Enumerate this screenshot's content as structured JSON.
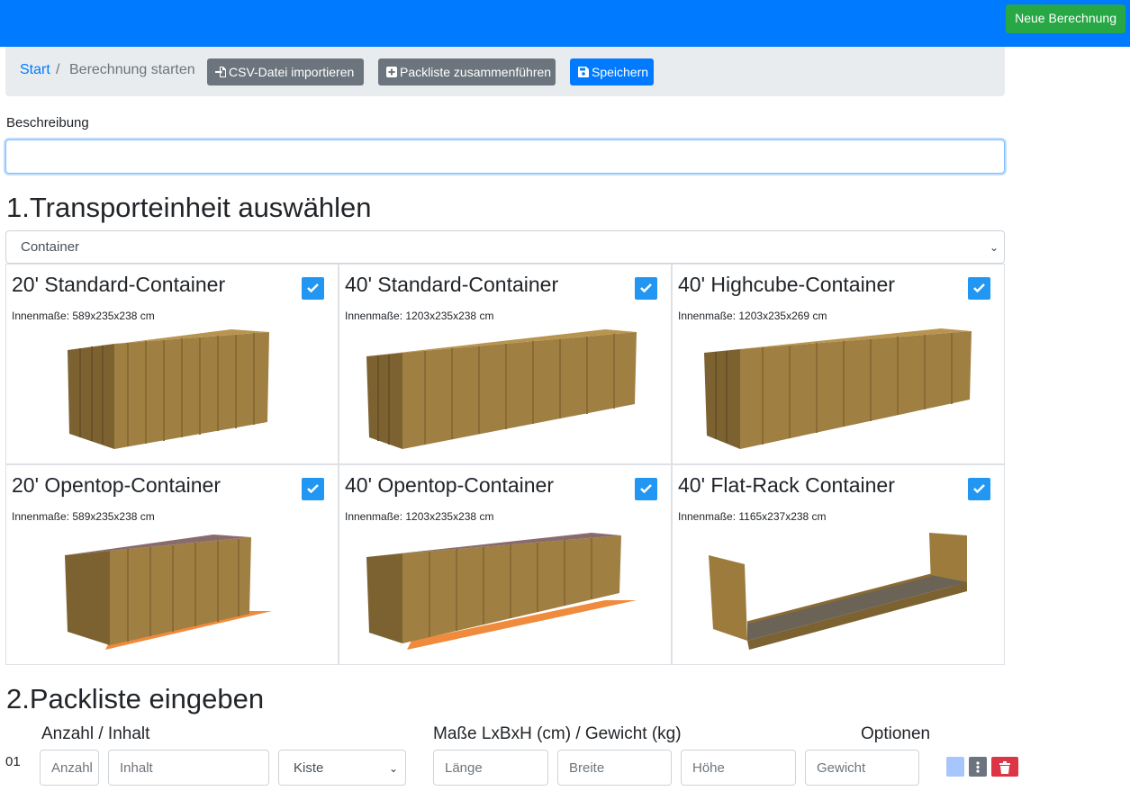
{
  "header": {
    "new_button": "Neue Berechnung"
  },
  "breadcrumb": {
    "start": "Start",
    "separator": "/",
    "current": "Berechnung starten"
  },
  "toolbar": {
    "csv_import": "CSV-Datei importieren",
    "merge_packlist": "Packliste zusammenführen",
    "save": "Speichern"
  },
  "description": {
    "label": "Beschreibung",
    "value": ""
  },
  "section1": {
    "title": "1.Transporteinheit auswählen",
    "select_value": "Container",
    "cards": [
      {
        "title": "20' Standard-Container",
        "dims": "Innenmaße: 589x235x238 cm",
        "checked": true,
        "icon": "standard-container-20"
      },
      {
        "title": "40' Standard-Container",
        "dims": "Innenmaße: 1203x235x238 cm",
        "checked": true,
        "icon": "standard-container-40"
      },
      {
        "title": "40' Highcube-Container",
        "dims": "Innenmaße: 1203x235x269 cm",
        "checked": true,
        "icon": "highcube-container-40"
      },
      {
        "title": "20' Opentop-Container",
        "dims": "Innenmaße: 589x235x238 cm",
        "checked": true,
        "icon": "opentop-container-20"
      },
      {
        "title": "40' Opentop-Container",
        "dims": "Innenmaße: 1203x235x238 cm",
        "checked": true,
        "icon": "opentop-container-40"
      },
      {
        "title": "40' Flat-Rack Container",
        "dims": "Innenmaße: 1165x237x238 cm",
        "checked": true,
        "icon": "flat-rack-container-40"
      }
    ]
  },
  "section2": {
    "title": "2.Packliste eingeben",
    "col_quantity": "Anzahl / Inhalt",
    "col_dims": "Maße LxBxH (cm) / Gewicht (kg)",
    "col_options": "Optionen",
    "row": {
      "number": "01",
      "quantity_placeholder": "Anzahl",
      "content_placeholder": "Inhalt",
      "type_value": "Kiste",
      "length_placeholder": "Länge",
      "width_placeholder": "Breite",
      "height_placeholder": "Höhe",
      "weight_placeholder": "Gewicht"
    }
  },
  "colors": {
    "primary": "#007bff",
    "success": "#28a745",
    "secondary": "#6c757d",
    "check": "#2196f3",
    "danger": "#dc3545",
    "container": "#9c7b3c"
  }
}
